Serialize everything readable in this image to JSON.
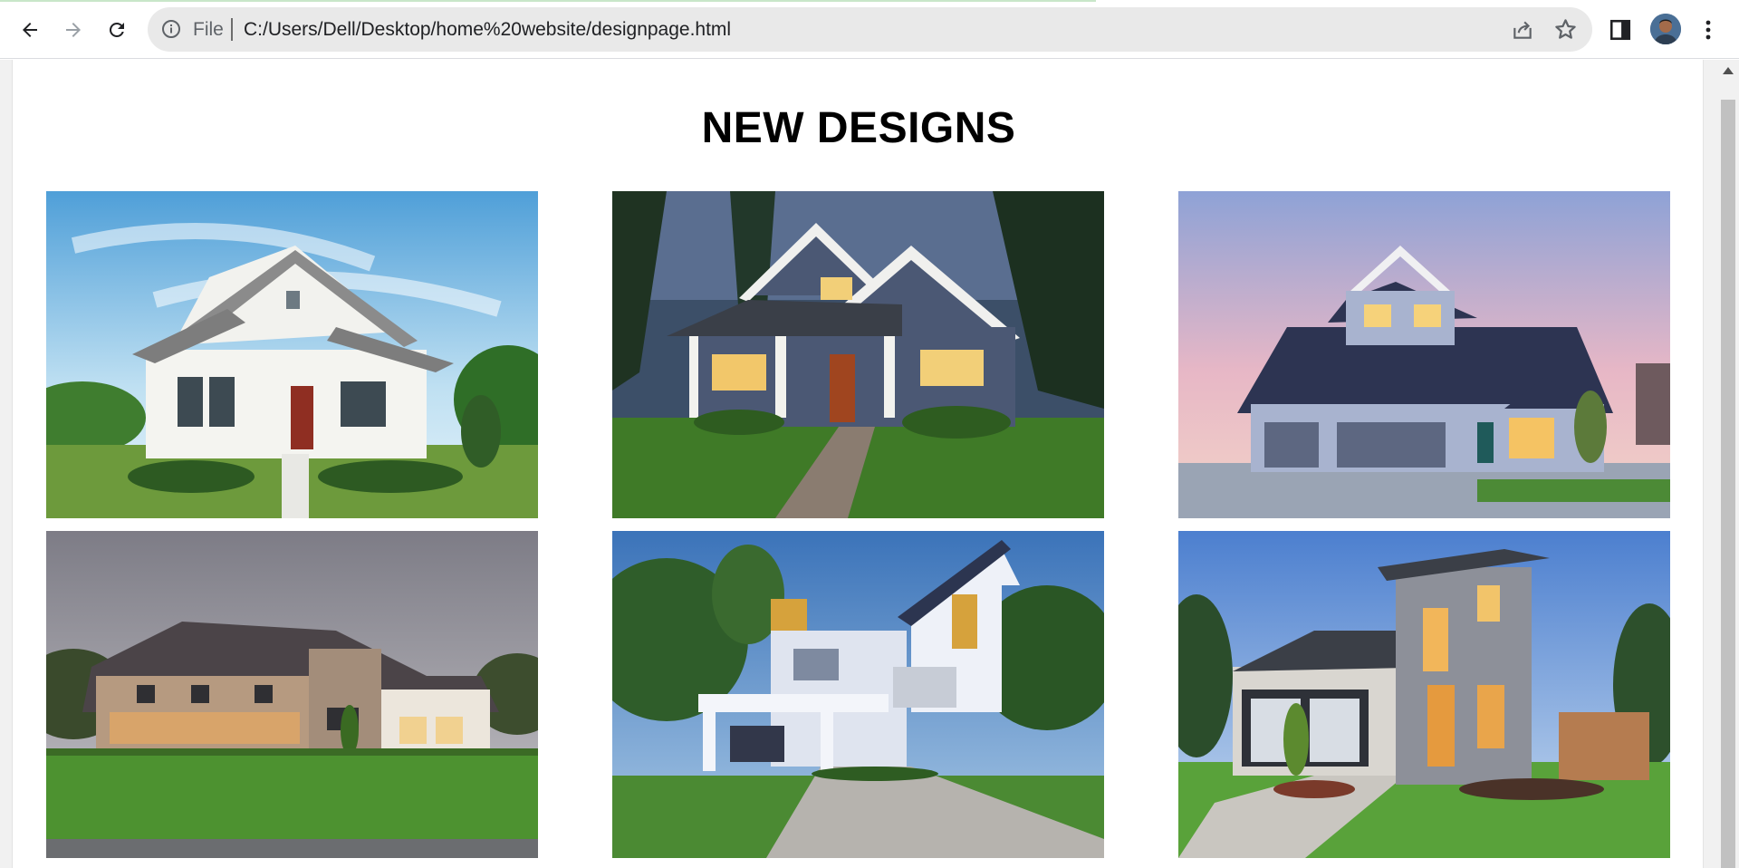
{
  "browser": {
    "address_scheme": "File",
    "address_url": "C:/Users/Dell/Desktop/home%20website/designpage.html",
    "icons": {
      "back": "arrow-left-icon",
      "forward": "arrow-right-icon",
      "reload": "reload-icon",
      "site_info": "info-icon",
      "share": "share-icon",
      "bookmark": "star-icon",
      "side_panel": "side-panel-icon",
      "menu": "kebab-menu-icon"
    }
  },
  "page": {
    "heading": "NEW DESIGNS",
    "designs": [
      {
        "style": "white farmhouse cottage"
      },
      {
        "style": "blue craftsman bungalow"
      },
      {
        "style": "navy two-storey with garage at dusk"
      },
      {
        "style": "stone and shingle estate"
      },
      {
        "style": "modern white villa with carport"
      },
      {
        "style": "contemporary grey home"
      }
    ]
  },
  "colors": {
    "page_background": "#ffffff",
    "heading": "#000000",
    "omnibox": "#e9e9e9",
    "scrollbar_thumb": "#c1c1c1"
  }
}
